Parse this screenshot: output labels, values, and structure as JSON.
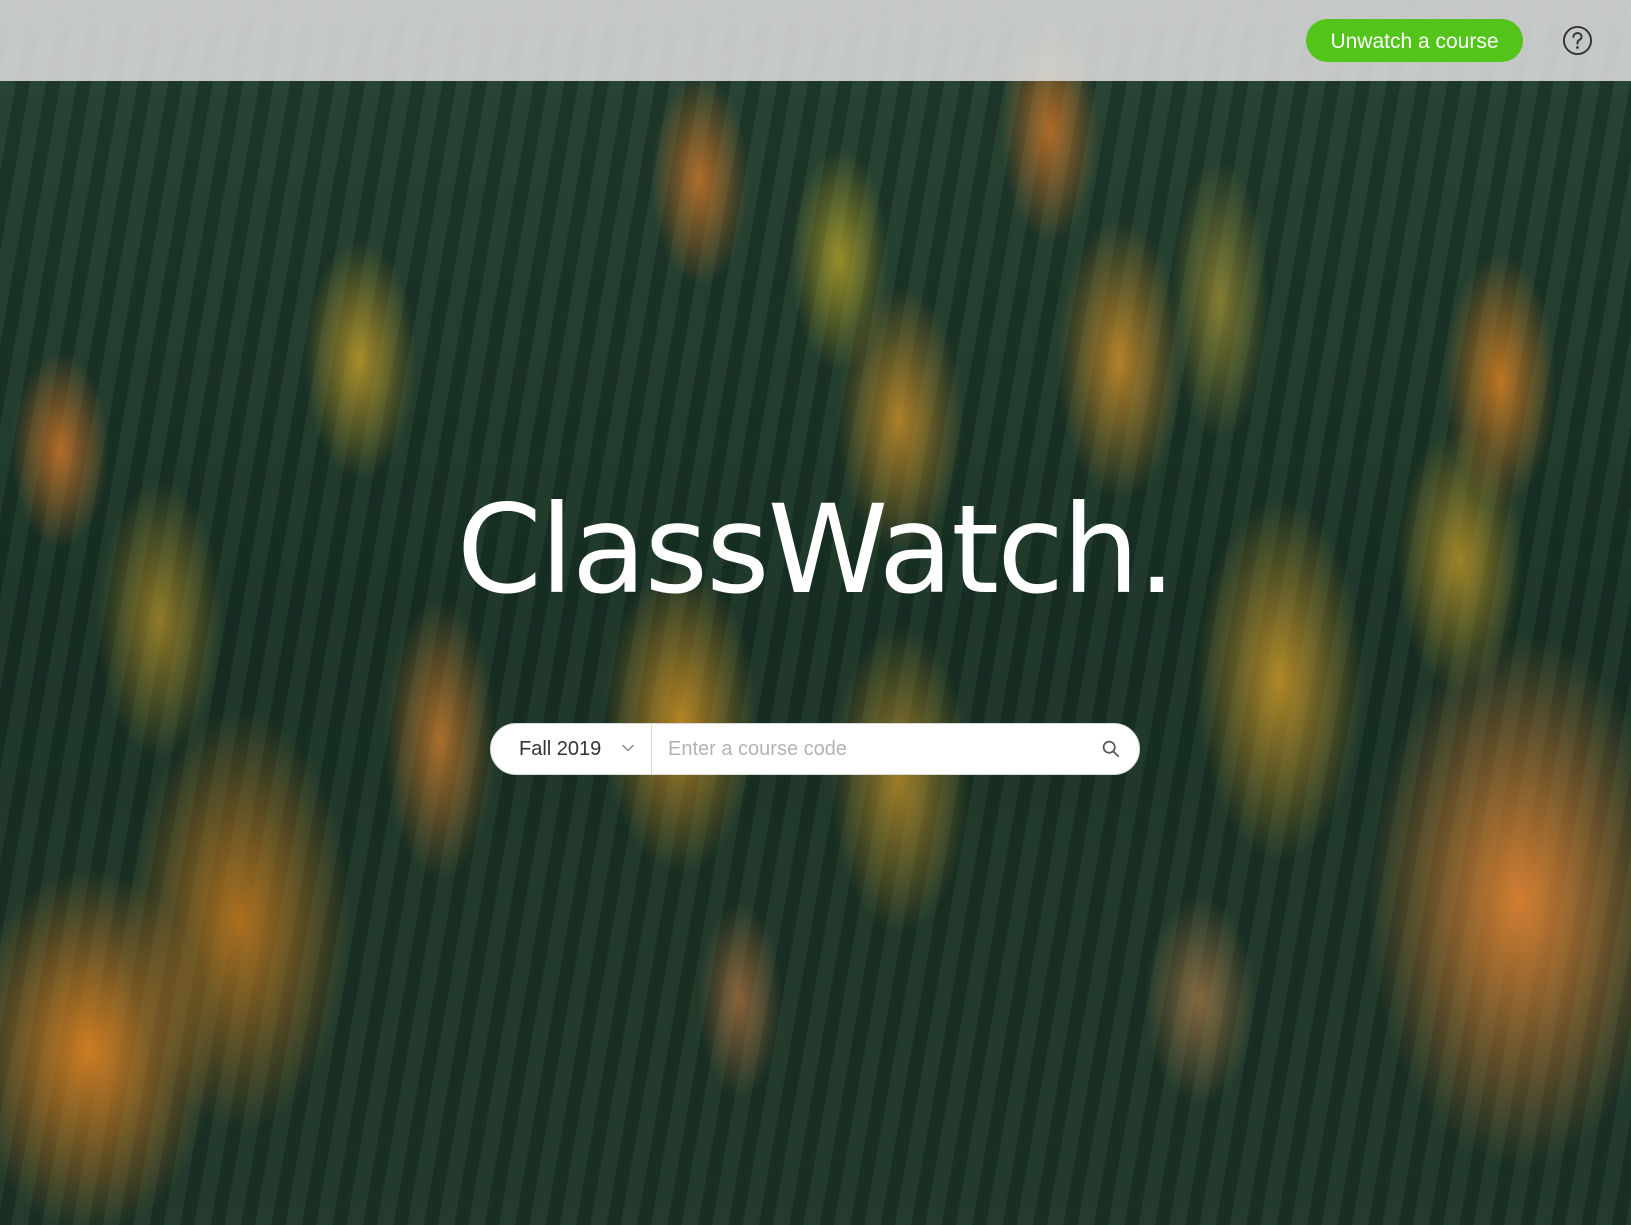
{
  "app": {
    "logo_text": "ClassWatch."
  },
  "header": {
    "unwatch_label": "Unwatch a course",
    "help_icon": "question-circle-icon",
    "accent_color": "#52c41a"
  },
  "search": {
    "term_selected": "Fall 2019",
    "course_placeholder": "Enter a course code",
    "course_value": "",
    "search_icon": "search-icon",
    "dropdown_icon": "chevron-down-icon"
  }
}
